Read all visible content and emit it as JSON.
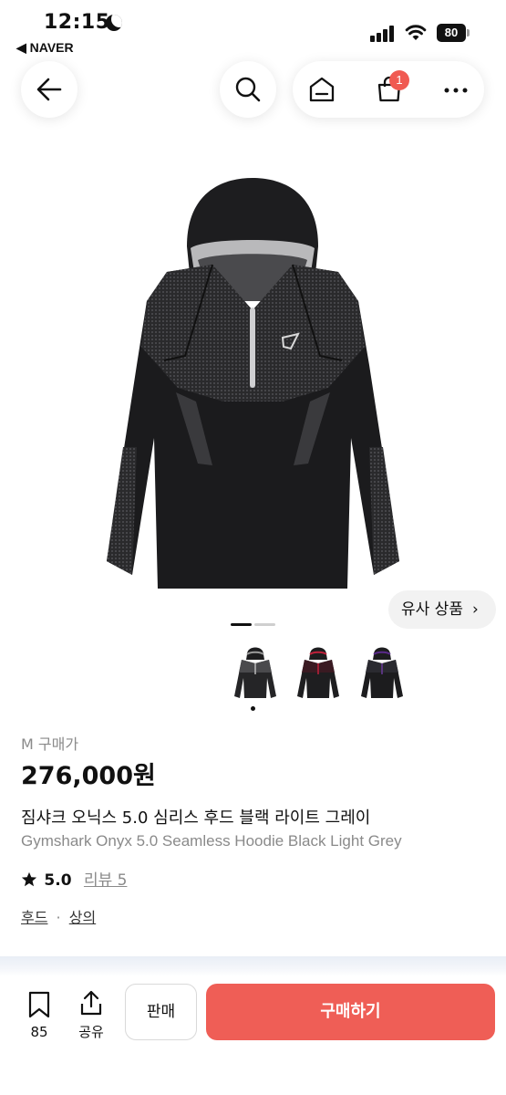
{
  "status_bar": {
    "time": "12:15",
    "back_app": "◀ NAVER",
    "battery": "80"
  },
  "header": {
    "cart_badge": "1"
  },
  "gallery": {
    "similar_products_label": "유사 상품",
    "similar_chevron": "›",
    "thumbnails": [
      {
        "name": "black-light-grey",
        "accent": "#9a9a9a"
      },
      {
        "name": "black-red",
        "accent": "#c0203a"
      },
      {
        "name": "black-purple",
        "accent": "#5a2a8a"
      }
    ],
    "indicator": {
      "active": 1,
      "total": 2
    }
  },
  "product": {
    "size_label": "M 구매가",
    "price": "276,000원",
    "title_ko": "짐샤크 오닉스 5.0 심리스 후드 블랙 라이트 그레이",
    "title_en": "Gymshark Onyx 5.0 Seamless Hoodie Black Light Grey",
    "rating": "5.0",
    "review_label": "리뷰 5",
    "categories": [
      "후드",
      "상의"
    ],
    "category_sep": "·"
  },
  "bottom_bar": {
    "bookmark_count": "85",
    "share_label": "공유",
    "sell_label": "판매",
    "buy_label": "구매하기"
  },
  "colors": {
    "accent": "#ef5e56",
    "badge": "#f05a52"
  },
  "icons": [
    "moon-icon",
    "signal-icon",
    "wifi-icon",
    "battery-icon",
    "back-arrow-icon",
    "search-icon",
    "home-icon",
    "shopping-bag-icon",
    "more-icon",
    "star-icon",
    "bookmark-icon",
    "share-icon"
  ]
}
